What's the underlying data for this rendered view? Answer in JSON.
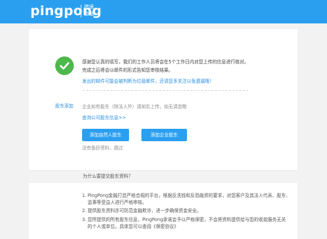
{
  "header": {
    "logo_text": "pingpong",
    "logo_sub_line1": "跨境",
    "logo_sub_line2": "金融"
  },
  "success": {
    "line1": "感谢您认真的填写，我们的工作人员将会在5个工作日内对您上传的信息进行核对。",
    "line2": "完成之后将会以邮件的形式告知您审核结果。",
    "spam_note": "发出的邮件可能会被判断为垃圾邮件，还请您多关注以免遗漏哦！"
  },
  "shareholder": {
    "section_label": "股东添加",
    "instruction": "企业如有股东（除法人外）请如实上传，如无请忽略",
    "query_link": "查询公司股东信息>>",
    "add_person_button": "添加自然人股东",
    "add_company_button": "添加企业股东",
    "no_shareholder_link": "没有备好资料，跳过"
  },
  "why": {
    "title": "为什么要提交股东资料？",
    "items": [
      {
        "number": "1.",
        "line1": "PingPong金融打造严格合规的平台，根据反洗钱和反恐融资的要求，对您客户及其法人代表、股东、",
        "line2": "监事等受益人进行严格审核。"
      },
      {
        "number": "2.",
        "line1": "提供股东资料亦可防范金融欺诈，进一步确保资金安全。",
        "line2": ""
      },
      {
        "number": "3.",
        "line1": "您所提供的所有股东信息，PingPong承诺会予以严格保密，不会将资料提供给与您的收款服务无关",
        "line2": "的个人或单位。具体您可以查阅《保密协议》"
      }
    ]
  },
  "colors": {
    "brand_blue": "#2a9ff0",
    "success_green": "#4db84b",
    "link_blue": "#2a8fe0"
  }
}
